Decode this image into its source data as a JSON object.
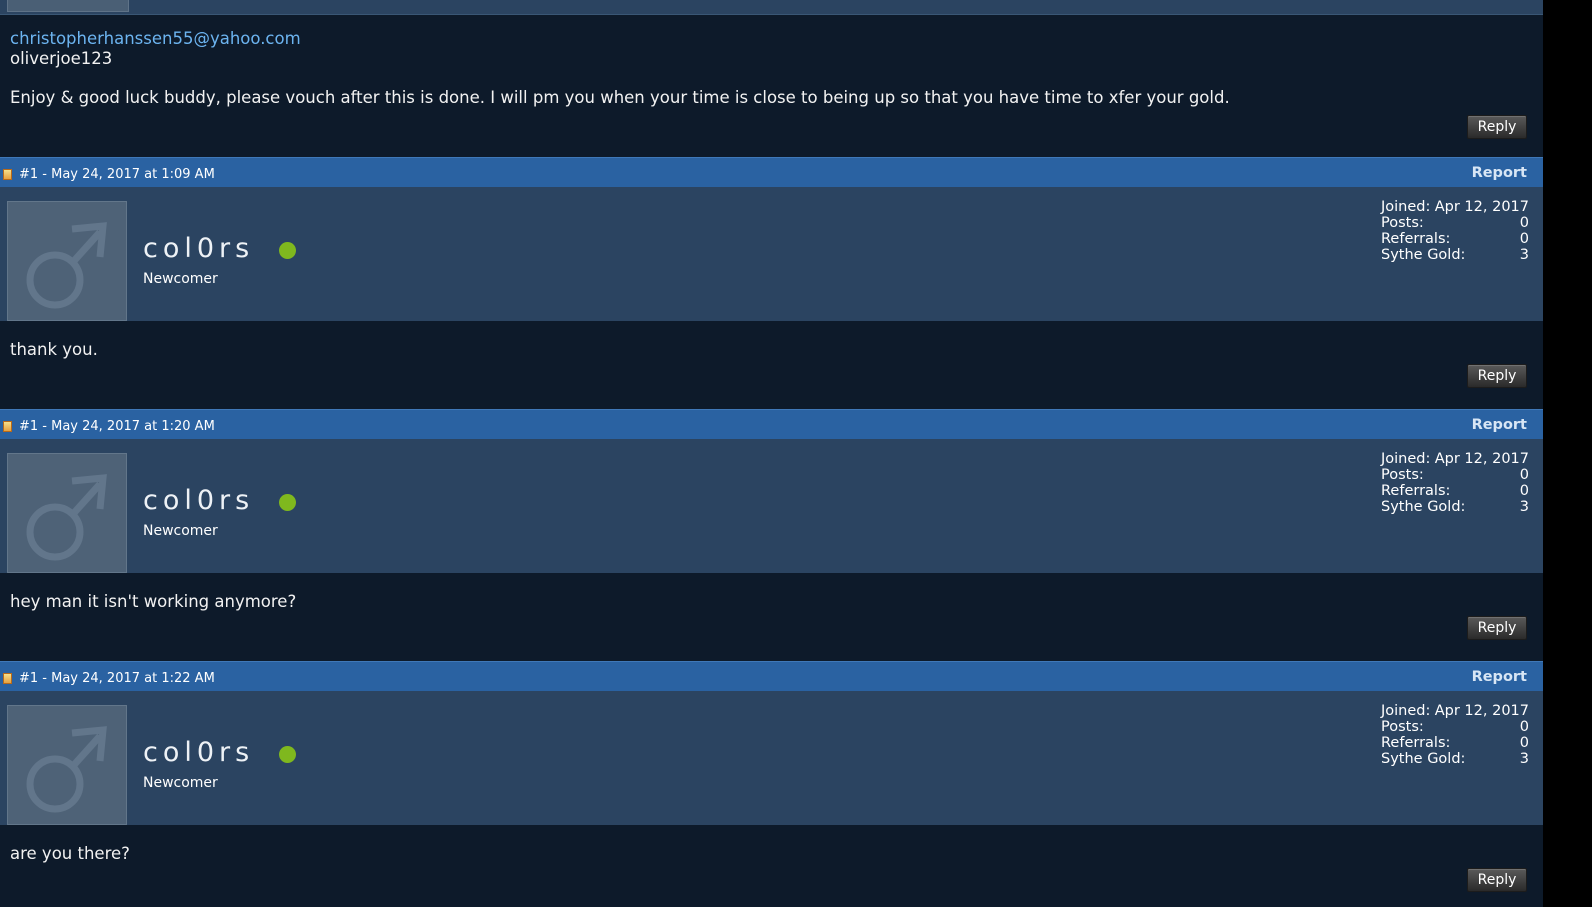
{
  "first_post": {
    "email": "christopherhanssen55@yahoo.com",
    "line2": "oliverjoe123",
    "message": "Enjoy & good luck buddy, please vouch after this is done. I will pm you when your time is close to being up so that you have time to xfer your gold.",
    "reply_label": "Reply"
  },
  "posts": [
    {
      "meta": "#1 - May 24, 2017 at 1:09 AM",
      "report_label": "Report",
      "username": "col0rs",
      "user_title": "Newcomer",
      "stats": [
        {
          "label": "Joined:",
          "value": "Apr 12, 2017"
        },
        {
          "label": "Posts:",
          "value": "0"
        },
        {
          "label": "Referrals:",
          "value": "0"
        },
        {
          "label": "Sythe Gold:",
          "value": "3"
        }
      ],
      "message": "thank you.",
      "reply_label": "Reply"
    },
    {
      "meta": "#1 - May 24, 2017 at 1:20 AM",
      "report_label": "Report",
      "username": "col0rs",
      "user_title": "Newcomer",
      "stats": [
        {
          "label": "Joined:",
          "value": "Apr 12, 2017"
        },
        {
          "label": "Posts:",
          "value": "0"
        },
        {
          "label": "Referrals:",
          "value": "0"
        },
        {
          "label": "Sythe Gold:",
          "value": "3"
        }
      ],
      "message": "hey man it isn't working anymore?",
      "reply_label": "Reply"
    },
    {
      "meta": "#1 - May 24, 2017 at 1:22 AM",
      "report_label": "Report",
      "username": "col0rs",
      "user_title": "Newcomer",
      "stats": [
        {
          "label": "Joined:",
          "value": "Apr 12, 2017"
        },
        {
          "label": "Posts:",
          "value": "0"
        },
        {
          "label": "Referrals:",
          "value": "0"
        },
        {
          "label": "Sythe Gold:",
          "value": "3"
        }
      ],
      "message": "are you there?",
      "reply_label": "Reply"
    }
  ],
  "colors": {
    "header_blue": "#2a62a2",
    "user_panel": "#2b4461",
    "body_bg": "#0d1a2a",
    "link": "#6cb4f0",
    "online": "#7fb81e"
  },
  "icons": [
    "post-icon",
    "male-avatar-icon",
    "online-status-icon"
  ]
}
